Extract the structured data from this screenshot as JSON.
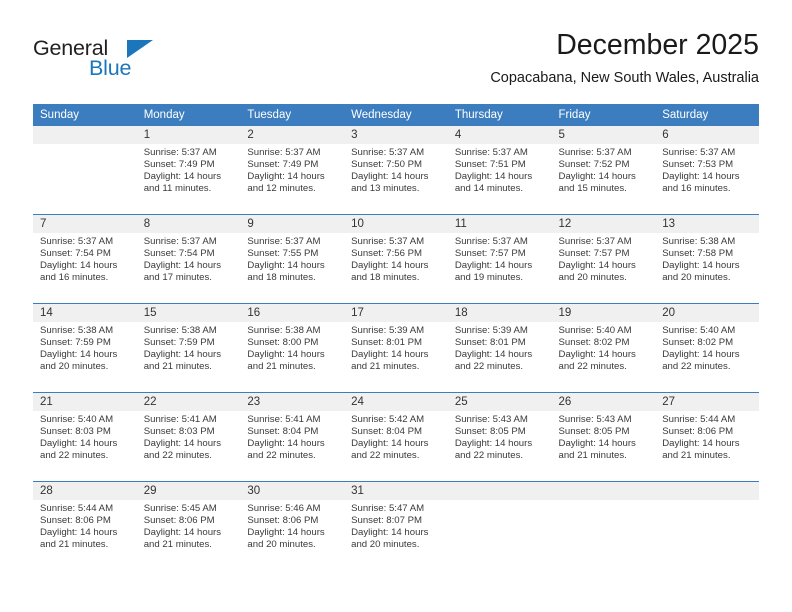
{
  "brand": {
    "name_dark": "General",
    "name_blue": "Blue",
    "color_blue": "#1b76bc",
    "color_dark": "#231f20"
  },
  "header": {
    "title": "December 2025",
    "subtitle": "Copacabana, New South Wales, Australia"
  },
  "theme": {
    "header_bg": "#3c7dbf",
    "header_text": "#ffffff",
    "daynum_bg": "#f0f0f0",
    "row_divider": "#3c7dbf",
    "body_text": "#3a3a3a"
  },
  "weekday_headers": [
    "Sunday",
    "Monday",
    "Tuesday",
    "Wednesday",
    "Thursday",
    "Friday",
    "Saturday"
  ],
  "weeks": [
    [
      {
        "day": "",
        "empty": true,
        "sunrise": "",
        "sunset": "",
        "daylight_line1": "",
        "daylight_line2": ""
      },
      {
        "day": "1",
        "empty": false,
        "sunrise": "Sunrise: 5:37 AM",
        "sunset": "Sunset: 7:49 PM",
        "daylight_line1": "Daylight: 14 hours",
        "daylight_line2": "and 11 minutes."
      },
      {
        "day": "2",
        "empty": false,
        "sunrise": "Sunrise: 5:37 AM",
        "sunset": "Sunset: 7:49 PM",
        "daylight_line1": "Daylight: 14 hours",
        "daylight_line2": "and 12 minutes."
      },
      {
        "day": "3",
        "empty": false,
        "sunrise": "Sunrise: 5:37 AM",
        "sunset": "Sunset: 7:50 PM",
        "daylight_line1": "Daylight: 14 hours",
        "daylight_line2": "and 13 minutes."
      },
      {
        "day": "4",
        "empty": false,
        "sunrise": "Sunrise: 5:37 AM",
        "sunset": "Sunset: 7:51 PM",
        "daylight_line1": "Daylight: 14 hours",
        "daylight_line2": "and 14 minutes."
      },
      {
        "day": "5",
        "empty": false,
        "sunrise": "Sunrise: 5:37 AM",
        "sunset": "Sunset: 7:52 PM",
        "daylight_line1": "Daylight: 14 hours",
        "daylight_line2": "and 15 minutes."
      },
      {
        "day": "6",
        "empty": false,
        "sunrise": "Sunrise: 5:37 AM",
        "sunset": "Sunset: 7:53 PM",
        "daylight_line1": "Daylight: 14 hours",
        "daylight_line2": "and 16 minutes."
      }
    ],
    [
      {
        "day": "7",
        "empty": false,
        "sunrise": "Sunrise: 5:37 AM",
        "sunset": "Sunset: 7:54 PM",
        "daylight_line1": "Daylight: 14 hours",
        "daylight_line2": "and 16 minutes."
      },
      {
        "day": "8",
        "empty": false,
        "sunrise": "Sunrise: 5:37 AM",
        "sunset": "Sunset: 7:54 PM",
        "daylight_line1": "Daylight: 14 hours",
        "daylight_line2": "and 17 minutes."
      },
      {
        "day": "9",
        "empty": false,
        "sunrise": "Sunrise: 5:37 AM",
        "sunset": "Sunset: 7:55 PM",
        "daylight_line1": "Daylight: 14 hours",
        "daylight_line2": "and 18 minutes."
      },
      {
        "day": "10",
        "empty": false,
        "sunrise": "Sunrise: 5:37 AM",
        "sunset": "Sunset: 7:56 PM",
        "daylight_line1": "Daylight: 14 hours",
        "daylight_line2": "and 18 minutes."
      },
      {
        "day": "11",
        "empty": false,
        "sunrise": "Sunrise: 5:37 AM",
        "sunset": "Sunset: 7:57 PM",
        "daylight_line1": "Daylight: 14 hours",
        "daylight_line2": "and 19 minutes."
      },
      {
        "day": "12",
        "empty": false,
        "sunrise": "Sunrise: 5:37 AM",
        "sunset": "Sunset: 7:57 PM",
        "daylight_line1": "Daylight: 14 hours",
        "daylight_line2": "and 20 minutes."
      },
      {
        "day": "13",
        "empty": false,
        "sunrise": "Sunrise: 5:38 AM",
        "sunset": "Sunset: 7:58 PM",
        "daylight_line1": "Daylight: 14 hours",
        "daylight_line2": "and 20 minutes."
      }
    ],
    [
      {
        "day": "14",
        "empty": false,
        "sunrise": "Sunrise: 5:38 AM",
        "sunset": "Sunset: 7:59 PM",
        "daylight_line1": "Daylight: 14 hours",
        "daylight_line2": "and 20 minutes."
      },
      {
        "day": "15",
        "empty": false,
        "sunrise": "Sunrise: 5:38 AM",
        "sunset": "Sunset: 7:59 PM",
        "daylight_line1": "Daylight: 14 hours",
        "daylight_line2": "and 21 minutes."
      },
      {
        "day": "16",
        "empty": false,
        "sunrise": "Sunrise: 5:38 AM",
        "sunset": "Sunset: 8:00 PM",
        "daylight_line1": "Daylight: 14 hours",
        "daylight_line2": "and 21 minutes."
      },
      {
        "day": "17",
        "empty": false,
        "sunrise": "Sunrise: 5:39 AM",
        "sunset": "Sunset: 8:01 PM",
        "daylight_line1": "Daylight: 14 hours",
        "daylight_line2": "and 21 minutes."
      },
      {
        "day": "18",
        "empty": false,
        "sunrise": "Sunrise: 5:39 AM",
        "sunset": "Sunset: 8:01 PM",
        "daylight_line1": "Daylight: 14 hours",
        "daylight_line2": "and 22 minutes."
      },
      {
        "day": "19",
        "empty": false,
        "sunrise": "Sunrise: 5:40 AM",
        "sunset": "Sunset: 8:02 PM",
        "daylight_line1": "Daylight: 14 hours",
        "daylight_line2": "and 22 minutes."
      },
      {
        "day": "20",
        "empty": false,
        "sunrise": "Sunrise: 5:40 AM",
        "sunset": "Sunset: 8:02 PM",
        "daylight_line1": "Daylight: 14 hours",
        "daylight_line2": "and 22 minutes."
      }
    ],
    [
      {
        "day": "21",
        "empty": false,
        "sunrise": "Sunrise: 5:40 AM",
        "sunset": "Sunset: 8:03 PM",
        "daylight_line1": "Daylight: 14 hours",
        "daylight_line2": "and 22 minutes."
      },
      {
        "day": "22",
        "empty": false,
        "sunrise": "Sunrise: 5:41 AM",
        "sunset": "Sunset: 8:03 PM",
        "daylight_line1": "Daylight: 14 hours",
        "daylight_line2": "and 22 minutes."
      },
      {
        "day": "23",
        "empty": false,
        "sunrise": "Sunrise: 5:41 AM",
        "sunset": "Sunset: 8:04 PM",
        "daylight_line1": "Daylight: 14 hours",
        "daylight_line2": "and 22 minutes."
      },
      {
        "day": "24",
        "empty": false,
        "sunrise": "Sunrise: 5:42 AM",
        "sunset": "Sunset: 8:04 PM",
        "daylight_line1": "Daylight: 14 hours",
        "daylight_line2": "and 22 minutes."
      },
      {
        "day": "25",
        "empty": false,
        "sunrise": "Sunrise: 5:43 AM",
        "sunset": "Sunset: 8:05 PM",
        "daylight_line1": "Daylight: 14 hours",
        "daylight_line2": "and 22 minutes."
      },
      {
        "day": "26",
        "empty": false,
        "sunrise": "Sunrise: 5:43 AM",
        "sunset": "Sunset: 8:05 PM",
        "daylight_line1": "Daylight: 14 hours",
        "daylight_line2": "and 21 minutes."
      },
      {
        "day": "27",
        "empty": false,
        "sunrise": "Sunrise: 5:44 AM",
        "sunset": "Sunset: 8:06 PM",
        "daylight_line1": "Daylight: 14 hours",
        "daylight_line2": "and 21 minutes."
      }
    ],
    [
      {
        "day": "28",
        "empty": false,
        "sunrise": "Sunrise: 5:44 AM",
        "sunset": "Sunset: 8:06 PM",
        "daylight_line1": "Daylight: 14 hours",
        "daylight_line2": "and 21 minutes."
      },
      {
        "day": "29",
        "empty": false,
        "sunrise": "Sunrise: 5:45 AM",
        "sunset": "Sunset: 8:06 PM",
        "daylight_line1": "Daylight: 14 hours",
        "daylight_line2": "and 21 minutes."
      },
      {
        "day": "30",
        "empty": false,
        "sunrise": "Sunrise: 5:46 AM",
        "sunset": "Sunset: 8:06 PM",
        "daylight_line1": "Daylight: 14 hours",
        "daylight_line2": "and 20 minutes."
      },
      {
        "day": "31",
        "empty": false,
        "sunrise": "Sunrise: 5:47 AM",
        "sunset": "Sunset: 8:07 PM",
        "daylight_line1": "Daylight: 14 hours",
        "daylight_line2": "and 20 minutes."
      },
      {
        "day": "",
        "empty": true,
        "sunrise": "",
        "sunset": "",
        "daylight_line1": "",
        "daylight_line2": ""
      },
      {
        "day": "",
        "empty": true,
        "sunrise": "",
        "sunset": "",
        "daylight_line1": "",
        "daylight_line2": ""
      },
      {
        "day": "",
        "empty": true,
        "sunrise": "",
        "sunset": "",
        "daylight_line1": "",
        "daylight_line2": ""
      }
    ]
  ]
}
